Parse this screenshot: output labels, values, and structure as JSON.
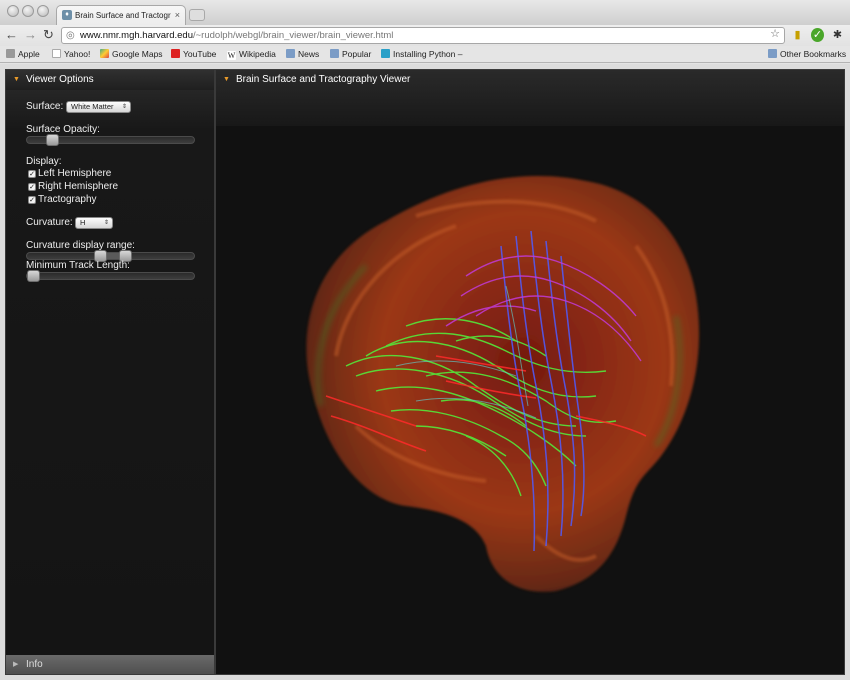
{
  "browser": {
    "tab_title": "Brain Surface and Tractograp",
    "tab_close": "×",
    "url_host": "www.nmr.mgh.harvard.edu",
    "url_path": "/~rudolph/webgl/brain_viewer/brain_viewer.html",
    "bookmarks": [
      "Apple",
      "Yahoo!",
      "Google Maps",
      "YouTube",
      "Wikipedia",
      "News",
      "Popular",
      "Installing Python –"
    ],
    "other_bookmarks": "Other Bookmarks"
  },
  "sidebar": {
    "title": "Viewer Options",
    "surface_label": "Surface:",
    "surface_value": "White Matter",
    "opacity_label": "Surface Opacity:",
    "opacity_value": 0.12,
    "display_label": "Display:",
    "checkboxes": [
      {
        "label": "Left Hemisphere",
        "checked": true
      },
      {
        "label": "Right Hemisphere",
        "checked": true
      },
      {
        "label": "Tractography",
        "checked": true
      }
    ],
    "curvature_label": "Curvature:",
    "curvature_value": "H",
    "curv_range_label": "Curvature display range:",
    "curv_range_low": 0.43,
    "curv_range_high": 0.59,
    "min_track_label": "Minimum Track Length:",
    "min_track_value": 0.0,
    "info_label": "Info"
  },
  "viewer": {
    "title": "Brain Surface and Tractography Viewer"
  },
  "colors": {
    "accent_arrow": "#e89a2a",
    "panel_bg": "#141414"
  }
}
